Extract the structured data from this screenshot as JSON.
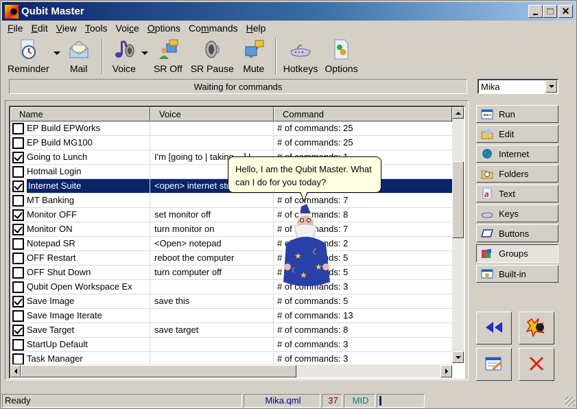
{
  "window": {
    "title": "Qubit Master",
    "controls": {
      "minimize": "_",
      "maximize": "□",
      "close": "✕"
    }
  },
  "menu": [
    {
      "label": "File",
      "accel": "F",
      "rest": "ile"
    },
    {
      "label": "Edit",
      "accel": "E",
      "rest": "dit"
    },
    {
      "label": "View",
      "accel": "V",
      "rest": "iew"
    },
    {
      "label": "Tools",
      "accel": "T",
      "rest": "ools"
    },
    {
      "label": "Voice",
      "pre": "Voi",
      "accel": "c",
      "rest": "e"
    },
    {
      "label": "Options",
      "accel": "O",
      "rest": "ptions"
    },
    {
      "label": "Commands",
      "pre": "Co",
      "accel": "m",
      "rest": "mands"
    },
    {
      "label": "Help",
      "accel": "H",
      "rest": "elp"
    }
  ],
  "toolbar": {
    "reminder": {
      "label": "Reminder",
      "icon": "reminder-clock-icon"
    },
    "mail": {
      "label": "Mail",
      "icon": "mail-envelope-icon"
    },
    "voice": {
      "label": "Voice",
      "icon": "voice-speaker-icon"
    },
    "sr_off": {
      "label": "SR Off",
      "icon": "speech-recognition-off-icon"
    },
    "sr_pause": {
      "label": "SR Pause",
      "icon": "speaker-pause-icon"
    },
    "mute": {
      "label": "Mute",
      "icon": "mute-monitor-icon"
    },
    "hotkeys": {
      "label": "Hotkeys",
      "icon": "keyboard-icon"
    },
    "options": {
      "label": "Options",
      "icon": "options-gear-icon"
    }
  },
  "status_message": "Waiting for commands",
  "profile": {
    "selected": "Mika"
  },
  "list": {
    "columns": [
      "Name",
      "Voice",
      "Command"
    ],
    "rows": [
      {
        "checked": false,
        "name": "EP Build EPWorks",
        "voice": "",
        "command": "# of commands: 25"
      },
      {
        "checked": false,
        "name": "EP Build MG100",
        "voice": "",
        "command": "# of commands: 25"
      },
      {
        "checked": true,
        "name": "Going to Lunch",
        "voice": "I'm [going to | taking ...] l...",
        "command": "# of commands: 1"
      },
      {
        "checked": false,
        "name": "Hotmail Login",
        "voice": "",
        "command": ""
      },
      {
        "checked": true,
        "name": "Internet Suite",
        "voice": "<open> internet stu...",
        "command": "",
        "selected": true
      },
      {
        "checked": false,
        "name": "MT Banking",
        "voice": "",
        "command": "# of commands: 7"
      },
      {
        "checked": true,
        "name": "Monitor OFF",
        "voice": "set monitor off",
        "command": "# of commands: 8"
      },
      {
        "checked": true,
        "name": "Monitor ON",
        "voice": "turn monitor on",
        "command": "# of commands: 7"
      },
      {
        "checked": false,
        "name": "Notepad SR",
        "voice": "<Open> notepad",
        "command": "# of commands: 2"
      },
      {
        "checked": false,
        "name": "OFF Restart",
        "voice": "reboot the computer",
        "command": "# of commands: 5"
      },
      {
        "checked": false,
        "name": "OFF Shut Down",
        "voice": "turn computer off",
        "command": "# of commands: 5"
      },
      {
        "checked": false,
        "name": "Qubit Open Workspace Ex",
        "voice": "",
        "command": "# of commands: 3"
      },
      {
        "checked": true,
        "name": "Save Image",
        "voice": "save this",
        "command": "# of commands: 5"
      },
      {
        "checked": false,
        "name": "Save Image Iterate",
        "voice": "",
        "command": "# of commands: 13"
      },
      {
        "checked": true,
        "name": "Save Target",
        "voice": "save target",
        "command": "# of commands: 8"
      },
      {
        "checked": false,
        "name": "StartUp Default",
        "voice": "",
        "command": "# of commands: 3"
      },
      {
        "checked": false,
        "name": "Task Manager",
        "voice": "",
        "command": "# of commands: 3"
      }
    ]
  },
  "assistant": {
    "balloon_text": "Hello, I am the Qubit Master. What can I do for you today?",
    "character": "wizard"
  },
  "side_buttons": [
    {
      "label": "Run",
      "icon": "run-window-icon"
    },
    {
      "label": "Edit",
      "icon": "edit-folder-icon"
    },
    {
      "label": "Internet",
      "icon": "globe-icon"
    },
    {
      "label": "Folders",
      "icon": "folder-search-icon"
    },
    {
      "label": "Text",
      "icon": "text-document-icon"
    },
    {
      "label": "Keys",
      "icon": "keyboard-icon"
    },
    {
      "label": "Buttons",
      "icon": "button-icon"
    },
    {
      "label": "Groups",
      "icon": "groups-icon",
      "active": true
    },
    {
      "label": "Built-in",
      "icon": "builtin-window-icon"
    }
  ],
  "action_buttons": {
    "back": "rewind-icon",
    "explode": "explosion-bomb-icon",
    "edit_form": "edit-form-icon",
    "delete": "delete-x-icon"
  },
  "statusbar": {
    "ready": "Ready",
    "file": "Mika.qml",
    "count": "37",
    "mode": "MID",
    "colors": {
      "file": "#000080",
      "count": "#800000",
      "mode": "#008080"
    }
  }
}
